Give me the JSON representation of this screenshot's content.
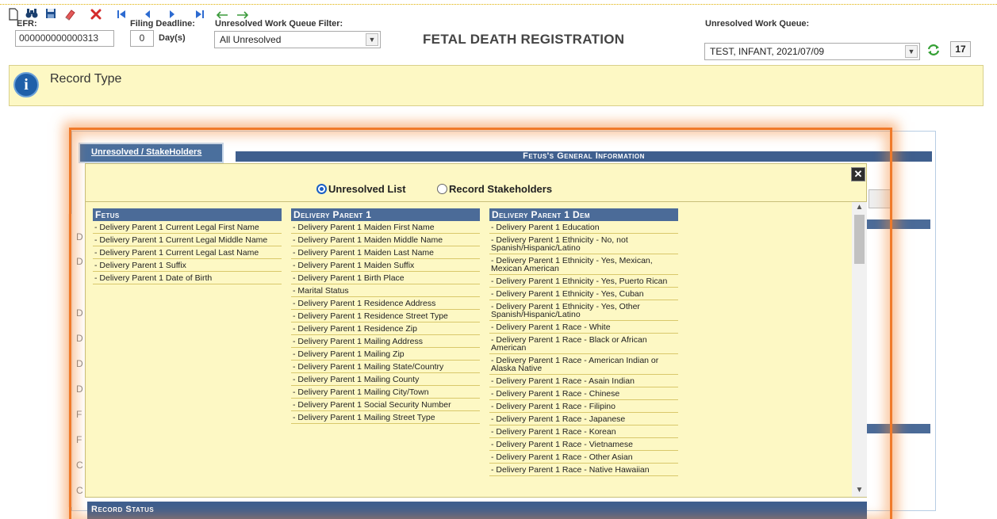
{
  "toolbar": {
    "icons": [
      "new-document-icon",
      "binoculars-icon",
      "save-disk-icon",
      "eraser-icon",
      "delete-x-icon",
      "first-record-icon",
      "previous-record-icon",
      "next-record-icon",
      "last-record-icon",
      "back-arrow-icon",
      "forward-arrow-icon"
    ],
    "efr_label": "EFR:",
    "efr_value": "000000000000313",
    "filing_deadline_label": "Filing Deadline:",
    "filing_deadline_value": "0",
    "filing_deadline_unit": "Day(s)",
    "filter_label": "Unresolved Work Queue Filter:",
    "filter_value": "All Unresolved",
    "form_title": "FETAL DEATH REGISTRATION",
    "queue_label": "Unresolved Work Queue:",
    "queue_value": "TEST, INFANT, 2021/07/09",
    "queue_count": "17"
  },
  "info_bar": {
    "icon": "info-icon",
    "title": "Record Type"
  },
  "background": {
    "tab_label": "Unresolved / StakeHolders",
    "section_header": "Fetus's General Information",
    "record_status": "Record Status"
  },
  "popup": {
    "radio_unresolved": "Unresolved List",
    "radio_stakeholders": "Record Stakeholders",
    "selected": "Unresolved List",
    "columns": [
      {
        "header": "Fetus",
        "items": [
          "- Delivery Parent 1 Current Legal First Name",
          "- Delivery Parent 1 Current Legal Middle Name",
          "- Delivery Parent 1 Current Legal Last Name",
          "- Delivery Parent 1 Suffix",
          "- Delivery Parent 1 Date of Birth"
        ]
      },
      {
        "header": "Delivery Parent 1",
        "items": [
          "- Delivery Parent 1 Maiden First Name",
          "- Delivery Parent 1 Maiden Middle Name",
          "- Delivery Parent 1 Maiden Last Name",
          "- Delivery Parent 1 Maiden Suffix",
          "- Delivery Parent 1 Birth Place",
          "- Marital Status",
          "- Delivery Parent 1 Residence Address",
          "- Delivery Parent 1 Residence Street Type",
          "- Delivery Parent 1 Residence Zip",
          "- Delivery Parent 1 Mailing Address",
          "- Delivery Parent 1 Mailing Zip",
          "- Delivery Parent 1 Mailing State/Country",
          "- Delivery Parent 1 Mailing County",
          "- Delivery Parent 1 Mailing City/Town",
          "- Delivery Parent 1 Social Security Number",
          "- Delivery Parent 1 Mailing Street Type"
        ]
      },
      {
        "header": "Delivery Parent 1 Dem",
        "items": [
          "- Delivery Parent 1 Education",
          "- Delivery Parent 1 Ethnicity - No, not Spanish/Hispanic/Latino",
          "- Delivery Parent 1 Ethnicity - Yes, Mexican, Mexican American",
          "- Delivery Parent 1 Ethnicity - Yes, Puerto Rican",
          "- Delivery Parent 1 Ethnicity - Yes, Cuban",
          "- Delivery Parent 1 Ethnicity - Yes, Other Spanish/Hispanic/Latino",
          "- Delivery Parent 1 Race - White",
          "- Delivery Parent 1 Race - Black or African American",
          "- Delivery Parent 1 Race - American Indian or Alaska Native",
          "- Delivery Parent 1 Race - Asain Indian",
          "- Delivery Parent 1 Race - Chinese",
          "- Delivery Parent 1 Race - Filipino",
          "- Delivery Parent 1 Race - Japanese",
          "- Delivery Parent 1 Race - Korean",
          "- Delivery Parent 1 Race - Vietnamese",
          "- Delivery Parent 1 Race - Other Asian",
          "- Delivery Parent 1 Race - Native Hawaiian"
        ]
      }
    ]
  },
  "colors": {
    "header_blue": "#4b6b98",
    "popup_yellow": "#fdf8c4",
    "highlight_orange": "#f07a2a"
  }
}
